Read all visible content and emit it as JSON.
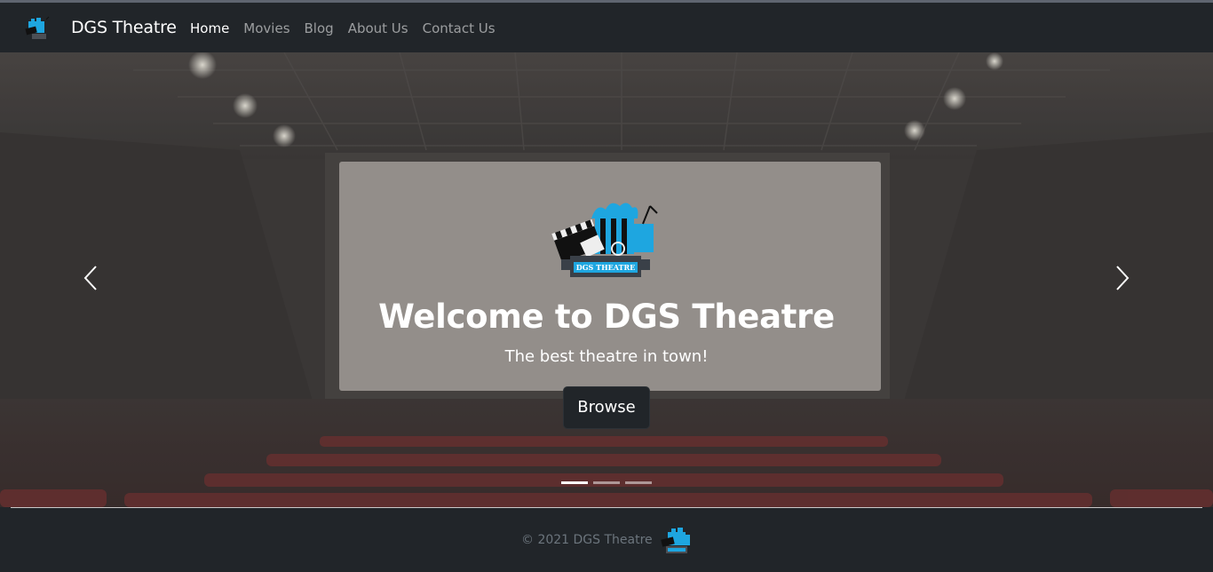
{
  "navbar": {
    "brand": "DGS Theatre",
    "brand_icon": "theatre-logo-icon",
    "items": [
      {
        "label": "Home",
        "active": true
      },
      {
        "label": "Movies",
        "active": false
      },
      {
        "label": "Blog",
        "active": false
      },
      {
        "label": "About Us",
        "active": false
      },
      {
        "label": "Contact Us",
        "active": false
      }
    ]
  },
  "carousel": {
    "logo_text": "DGS THEATRE",
    "title": "Welcome to DGS Theatre",
    "subtitle": "The best theatre in town!",
    "button_label": "Browse",
    "prev_icon": "chevron-left-icon",
    "next_icon": "chevron-right-icon",
    "slide_count": 3,
    "active_slide": 1
  },
  "footer": {
    "copyright": "© 2021 DGS Theatre"
  },
  "colors": {
    "navbar_bg": "#212529",
    "button_bg": "#212529",
    "logo_blue": "#1ea6e0",
    "nav_muted": "rgba(255,255,255,0.55)"
  }
}
